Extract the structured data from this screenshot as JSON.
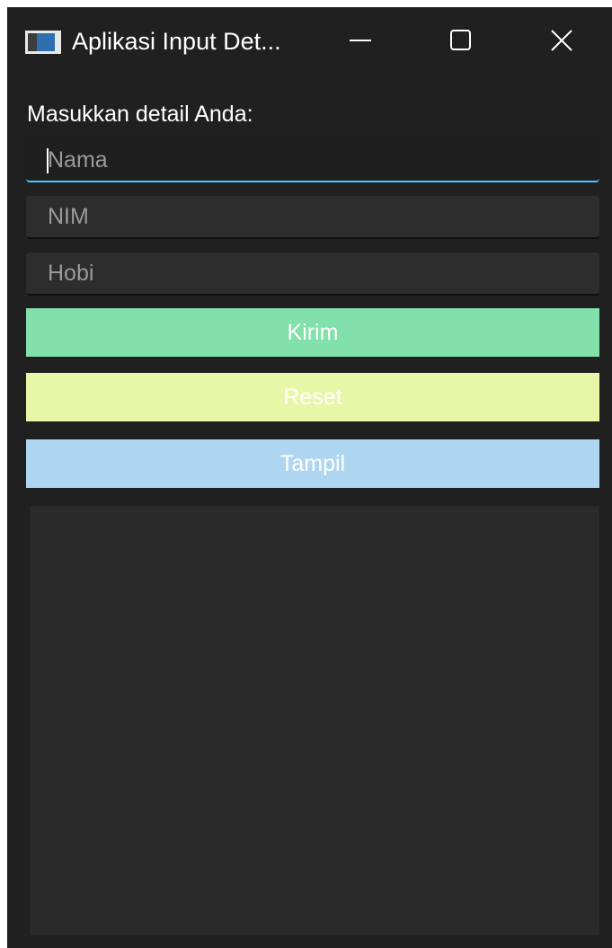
{
  "window": {
    "title": "Aplikasi Input Det...",
    "controls": {
      "minimize_icon": "minimize-icon",
      "maximize_icon": "maximize-icon",
      "close_icon": "close-icon"
    }
  },
  "form": {
    "prompt": "Masukkan detail Anda:",
    "fields": [
      {
        "placeholder": "Nama",
        "value": ""
      },
      {
        "placeholder": "NIM",
        "value": ""
      },
      {
        "placeholder": "Hobi",
        "value": ""
      }
    ]
  },
  "buttons": {
    "submit": {
      "label": "Kirim",
      "color": "#82e0aa"
    },
    "reset": {
      "label": "Reset",
      "color": "#e8f6a8"
    },
    "show": {
      "label": "Tampil",
      "color": "#aed6f1"
    }
  },
  "output": {
    "text": ""
  },
  "colors": {
    "window_bg": "#202020",
    "field_bg": "#2d2d2d",
    "focus_accent": "#4cc2ff"
  }
}
